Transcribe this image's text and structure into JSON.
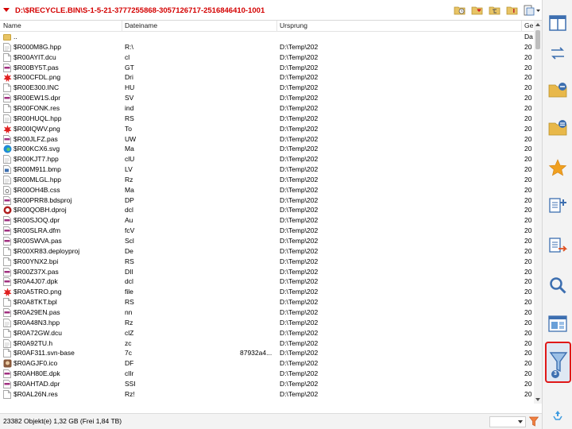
{
  "path": {
    "text": "D:\\$RECYCLE.BIN\\S-1-5-21-3777255868-3057126717-2516846410-1001"
  },
  "columns": {
    "name": "Name",
    "filename": "Dateiname",
    "origin": "Ursprung",
    "date": "Ge"
  },
  "parent_row": {
    "name": "..",
    "date": "Da"
  },
  "rows": [
    {
      "name": "$R000M8G.hpp",
      "file": "R:\\",
      "origin": "D:\\Temp\\202",
      "date": "20",
      "icon": "file-doc-icon"
    },
    {
      "name": "$R00AYIT.dcu",
      "file": "cl",
      "origin": "D:\\Temp\\202",
      "date": "20",
      "icon": "file-blank-icon"
    },
    {
      "name": "$R00BY5T.pas",
      "file": "GT",
      "origin": "D:\\Temp\\202",
      "date": "20",
      "icon": "file-pas-icon"
    },
    {
      "name": "$R00CFDL.png",
      "file": "Dri",
      "origin": "D:\\Temp\\202",
      "date": "20",
      "icon": "image-png-icon"
    },
    {
      "name": "$R00E300.INC",
      "file": "HU",
      "origin": "D:\\Temp\\202",
      "date": "20",
      "icon": "file-blank-icon"
    },
    {
      "name": "$R00EW1S.dpr",
      "file": "SV",
      "origin": "D:\\Temp\\202",
      "date": "20",
      "icon": "file-pas-icon"
    },
    {
      "name": "$R00FONK.res",
      "file": "ind",
      "origin": "D:\\Temp\\202",
      "date": "20",
      "icon": "file-blank-icon"
    },
    {
      "name": "$R00HUQL.hpp",
      "file": "RS",
      "origin": "D:\\Temp\\202",
      "date": "20",
      "icon": "file-doc-icon"
    },
    {
      "name": "$R00IQWV.png",
      "file": "To",
      "origin": "D:\\Temp\\202",
      "date": "20",
      "icon": "image-png-icon"
    },
    {
      "name": "$R00JLFZ.pas",
      "file": "UW",
      "origin": "D:\\Temp\\202",
      "date": "20",
      "icon": "file-pas-icon"
    },
    {
      "name": "$R00KCX6.svg",
      "file": "Ma",
      "origin": "D:\\Temp\\202",
      "date": "20",
      "icon": "edge-svg-icon"
    },
    {
      "name": "$R00KJT7.hpp",
      "file": "clU",
      "origin": "D:\\Temp\\202",
      "date": "20",
      "icon": "file-doc-icon"
    },
    {
      "name": "$R00M911.bmp",
      "file": "LV",
      "origin": "D:\\Temp\\202",
      "date": "20",
      "icon": "file-bmp-icon"
    },
    {
      "name": "$R00MLGL.hpp",
      "file": "Rz",
      "origin": "D:\\Temp\\202",
      "date": "20",
      "icon": "file-doc-icon"
    },
    {
      "name": "$R00OH4B.css",
      "file": "Ma",
      "origin": "D:\\Temp\\202",
      "date": "20",
      "icon": "file-css-icon"
    },
    {
      "name": "$R00PRR8.bdsproj",
      "file": "DP",
      "origin": "D:\\Temp\\202",
      "date": "20",
      "icon": "file-pas-icon"
    },
    {
      "name": "$R00QOBH.dproj",
      "file": "dcl",
      "origin": "D:\\Temp\\202",
      "date": "20",
      "icon": "dproj-icon"
    },
    {
      "name": "$R00SJOQ.dpr",
      "file": "Au",
      "origin": "D:\\Temp\\202",
      "date": "20",
      "icon": "file-pas-icon"
    },
    {
      "name": "$R00SLRA.dfm",
      "file": "fcV",
      "origin": "D:\\Temp\\202",
      "date": "20",
      "icon": "file-pas-icon"
    },
    {
      "name": "$R00SWVA.pas",
      "file": "Scl",
      "origin": "D:\\Temp\\202",
      "date": "20",
      "icon": "file-pas-icon"
    },
    {
      "name": "$R00XR83.deployproj",
      "file": "De",
      "origin": "D:\\Temp\\202",
      "date": "20",
      "icon": "file-blank-icon"
    },
    {
      "name": "$R00YNX2.bpi",
      "file": "RS",
      "origin": "D:\\Temp\\202",
      "date": "20",
      "icon": "file-blank-icon"
    },
    {
      "name": "$R00Z37X.pas",
      "file": "DII",
      "origin": "D:\\Temp\\202",
      "date": "20",
      "icon": "file-pas-icon"
    },
    {
      "name": "$R0A4J07.dpk",
      "file": "dcl",
      "origin": "D:\\Temp\\202",
      "date": "20",
      "icon": "file-pas-icon"
    },
    {
      "name": "$R0A5TRO.png",
      "file": "file",
      "origin": "D:\\Temp\\202",
      "date": "20",
      "icon": "image-png-icon"
    },
    {
      "name": "$R0A8TKT.bpl",
      "file": "RS",
      "origin": "D:\\Temp\\202",
      "date": "20",
      "icon": "file-blank-icon"
    },
    {
      "name": "$R0A29EN.pas",
      "file": "nn",
      "origin": "D:\\Temp\\202",
      "date": "20",
      "icon": "file-pas-icon"
    },
    {
      "name": "$R0A48N3.hpp",
      "file": "Rz",
      "origin": "D:\\Temp\\202",
      "date": "20",
      "icon": "file-doc-icon"
    },
    {
      "name": "$R0A72GW.dcu",
      "file": "clZ",
      "origin": "D:\\Temp\\202",
      "date": "20",
      "icon": "file-blank-icon"
    },
    {
      "name": "$R0A92TU.h",
      "file": "zc",
      "origin": "D:\\Temp\\202",
      "date": "20",
      "icon": "file-doc-icon"
    },
    {
      "name": "$R0AF311.svn-base",
      "file": "7c",
      "origin": "D:\\Temp\\202",
      "date": "20",
      "icon": "file-blank-icon",
      "extra": "87932a4..."
    },
    {
      "name": "$R0AGJF0.ico",
      "file": "DF",
      "origin": "D:\\Temp\\202",
      "date": "20",
      "icon": "ico-icon"
    },
    {
      "name": "$R0AH80E.dpk",
      "file": "clIr",
      "origin": "D:\\Temp\\202",
      "date": "20",
      "icon": "file-pas-icon"
    },
    {
      "name": "$R0AHTAD.dpr",
      "file": "SSI",
      "origin": "D:\\Temp\\202",
      "date": "20",
      "icon": "file-pas-icon"
    },
    {
      "name": "$R0AL26N.res",
      "file": "Rz!",
      "origin": "D:\\Temp\\202",
      "date": "20",
      "icon": "file-blank-icon"
    }
  ],
  "status": {
    "text": "23382 Objekt(e)  1,32 GB  (Frei 1,84 TB)"
  },
  "sidebar": {
    "filter_badge": "3"
  }
}
